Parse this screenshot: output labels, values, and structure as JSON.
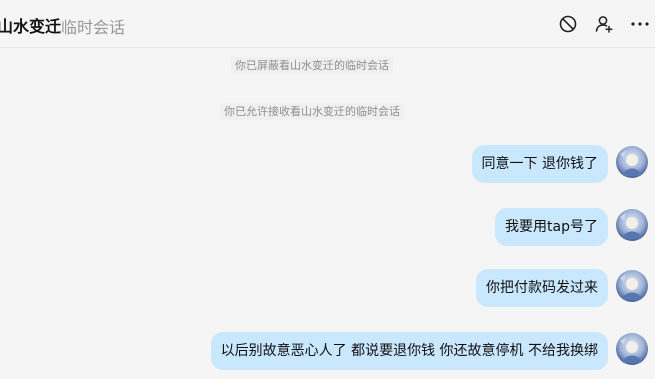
{
  "header": {
    "title": "山水变迁",
    "subtitle": "临时会话",
    "icons": [
      "block-icon",
      "add-user-icon",
      "more-icon"
    ]
  },
  "system_messages": [
    "你已屏蔽看山水变迁的临时会话",
    "你已允许接收看山水变迁的临时会话"
  ],
  "messages": [
    {
      "text": "同意一下 退你钱了"
    },
    {
      "text": "我要用tap号了"
    },
    {
      "text": "你把付款码发过来"
    },
    {
      "text": "以后别故意恶心人了  都说要退你钱  你还故意停机 不给我换绑"
    }
  ],
  "colors": {
    "background": "#f5f5f5",
    "bubble": "#c9e7fd",
    "system_text": "#8e8e8e"
  }
}
